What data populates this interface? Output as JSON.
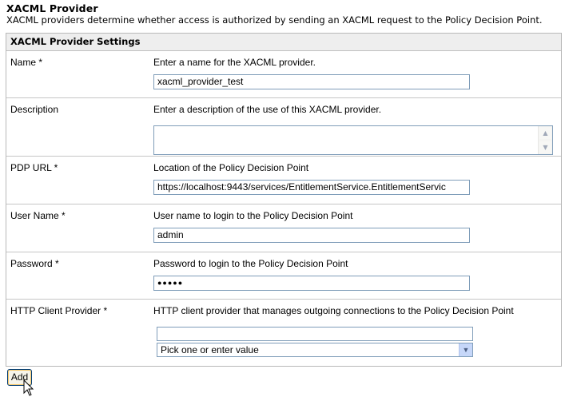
{
  "page": {
    "title": "XACML Provider",
    "description": "XACML providers determine whether access is authorized by sending an XACML request to the Policy Decision Point."
  },
  "section": {
    "header": "XACML Provider Settings"
  },
  "fields": {
    "name": {
      "label": "Name *",
      "help": "Enter a name for the XACML provider.",
      "value": "xacml_provider_test"
    },
    "description": {
      "label": "Description",
      "help": "Enter a description of the use of this XACML provider.",
      "value": ""
    },
    "pdp_url": {
      "label": "PDP URL *",
      "help": "Location of the Policy Decision Point",
      "value": "https://localhost:9443/services/EntitlementService.EntitlementServic"
    },
    "user_name": {
      "label": "User Name *",
      "help": "User name to login to the Policy Decision Point",
      "value": "admin"
    },
    "password": {
      "label": "Password *",
      "help": "Password to login to the Policy Decision Point",
      "value": "●●●●●"
    },
    "http_client_provider": {
      "label": "HTTP Client Provider *",
      "help": "HTTP client provider that manages outgoing connections to the Policy Decision Point",
      "value": "",
      "selected_option": "Pick one or enter value"
    }
  },
  "actions": {
    "add_label": "Add"
  },
  "icons": {
    "scroll_up": "scroll-up-arrow-icon",
    "scroll_down": "scroll-down-arrow-icon",
    "dropdown": "chevron-down-icon",
    "cursor": "mouse-pointer-icon"
  }
}
